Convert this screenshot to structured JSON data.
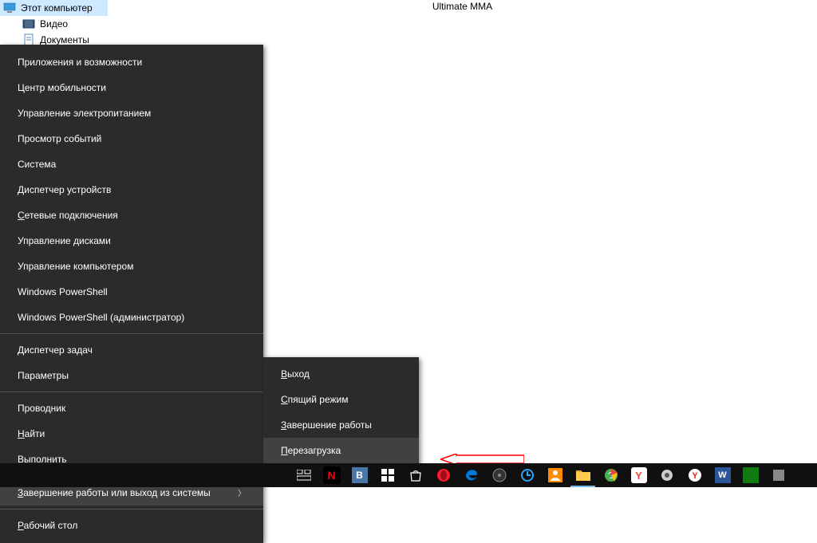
{
  "tree": {
    "items": [
      {
        "label": "Этот компьютер",
        "selected": true,
        "icon": "monitor"
      },
      {
        "label": "Видео",
        "selected": false,
        "icon": "video"
      },
      {
        "label": "Документы",
        "selected": false,
        "icon": "document"
      }
    ]
  },
  "window_title": "Ultimate MMA",
  "winx_menu": {
    "groups": [
      [
        "Приложения и возможности",
        "Центр мобильности",
        "Управление электропитанием",
        "Просмотр событий",
        "Система",
        "Диспетчер устройств",
        "Сетевые подключения",
        "Управление дисками",
        "Управление компьютером",
        "Windows PowerShell",
        "Windows PowerShell (администратор)"
      ],
      [
        "Диспетчер задач",
        "Параметры"
      ],
      [
        "Проводник",
        "Найти",
        "Выполнить"
      ]
    ],
    "shutdown_item": "Завершение работы или выход из системы",
    "desktop_item": "Рабочий стол"
  },
  "shutdown_submenu": [
    {
      "label": "Выход",
      "highlight": false
    },
    {
      "label": "Спящий режим",
      "highlight": false
    },
    {
      "label": "Завершение работы",
      "highlight": false
    },
    {
      "label": "Перезагрузка",
      "highlight": true
    }
  ],
  "taskbar": {
    "items": [
      {
        "name": "task-view",
        "color": "#ffffff"
      },
      {
        "name": "netflix",
        "color": "#e50914",
        "letter": "N"
      },
      {
        "name": "vk",
        "color": "#4a76a8",
        "letter": "В"
      },
      {
        "name": "windows-store",
        "color": "#ffffff"
      },
      {
        "name": "shopping-bag",
        "color": "#ffffff"
      },
      {
        "name": "opera",
        "color": "#ff1b2d"
      },
      {
        "name": "edge",
        "color": "#0078d7"
      },
      {
        "name": "media-player",
        "color": "#555555"
      },
      {
        "name": "app-update",
        "color": "#2aa4f4"
      },
      {
        "name": "people",
        "color": "#ff8c00"
      },
      {
        "name": "file-explorer",
        "color": "#ffcc4d",
        "active": true
      },
      {
        "name": "chrome",
        "color": "#4caf50"
      },
      {
        "name": "yandex",
        "color": "#ffcc00",
        "letter": "Y"
      },
      {
        "name": "settings-app",
        "color": "#cccccc"
      },
      {
        "name": "yandex-browser",
        "color": "#e52620",
        "letter": "Y"
      },
      {
        "name": "word",
        "color": "#2b579a",
        "letter": "W"
      },
      {
        "name": "app-green",
        "color": "#107c10"
      },
      {
        "name": "app-gray",
        "color": "#888888"
      }
    ]
  },
  "colors": {
    "menu_bg": "#2b2b2b",
    "menu_highlight": "#414141",
    "arrow_red": "#ff0000"
  }
}
